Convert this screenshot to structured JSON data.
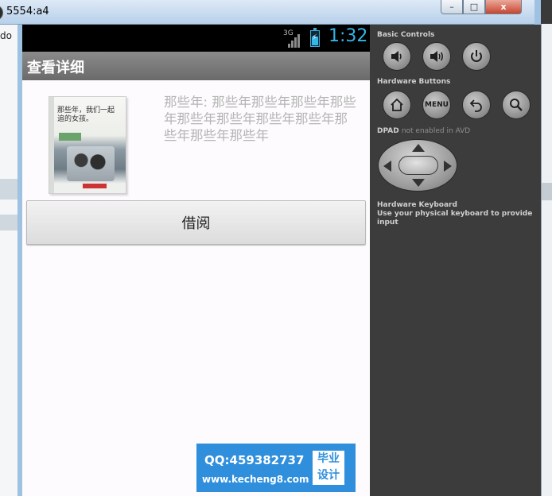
{
  "window": {
    "title": "5554:a4",
    "minimize_glyph": "–",
    "maximize_glyph": "□",
    "close_glyph": "x"
  },
  "background": {
    "left_text": "do"
  },
  "status_bar": {
    "network": "3G",
    "time": "1:32"
  },
  "action_bar": {
    "title": "查看详细"
  },
  "book": {
    "cover_text": "那些年，我们一起追的女孩。",
    "info_text": "那些年: 那些年那些年那些年那些年那些年那些年那些年那些年那些年那些年那些年"
  },
  "borrow_button": {
    "label": "借阅"
  },
  "watermark": {
    "qq": "QQ:459382737",
    "url": "www.kecheng8.com",
    "badge_line1": "毕业",
    "badge_line2": "设计"
  },
  "controls": {
    "basic_controls_label": "Basic Controls",
    "hardware_buttons_label": "Hardware Buttons",
    "menu_label": "MENU",
    "dpad_label": "DPAD",
    "dpad_note": "not enabled in AVD",
    "keyboard_label": "Hardware Keyboard",
    "keyboard_hint": "Use your physical keyboard to provide input",
    "icons": [
      "volume-down-icon",
      "volume-up-icon",
      "power-icon",
      "home-icon",
      "menu-button",
      "back-icon",
      "search-icon"
    ]
  },
  "colors": {
    "clock_blue": "#33b5e5",
    "watermark_blue": "#2f8fdc",
    "panel_dark": "#3c3c3c"
  }
}
